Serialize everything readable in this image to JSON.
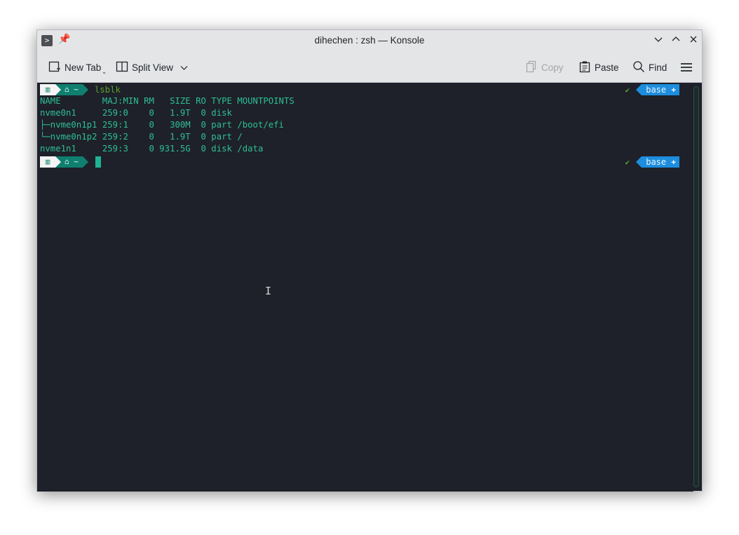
{
  "window": {
    "title": "dihechen : zsh — Konsole",
    "app_icon_glyph": ">",
    "controls": [
      "minimize",
      "maximize",
      "close"
    ]
  },
  "toolbar": {
    "new_tab": "New Tab",
    "split_view": "Split View",
    "copy": "Copy",
    "paste": "Paste",
    "find": "Find"
  },
  "terminal": {
    "prompt": {
      "home": "~",
      "env": "base"
    },
    "command": "lsblk",
    "output": [
      "NAME        MAJ:MIN RM   SIZE RO TYPE MOUNTPOINTS",
      "nvme0n1     259:0    0   1.9T  0 disk",
      "├─nvme0n1p1 259:1    0   300M  0 part /boot/efi",
      "└─nvme0n1p2 259:2    0   1.9T  0 part /",
      "nvme1n1     259:3    0 931.5G  0 disk /data"
    ]
  },
  "colors": {
    "terminal_bg": "#1e2129",
    "terminal_fg": "#2ebe98",
    "prompt_teal": "#0f7f70",
    "env_blue": "#1d8ddd",
    "command_green": "#5aa22e"
  }
}
